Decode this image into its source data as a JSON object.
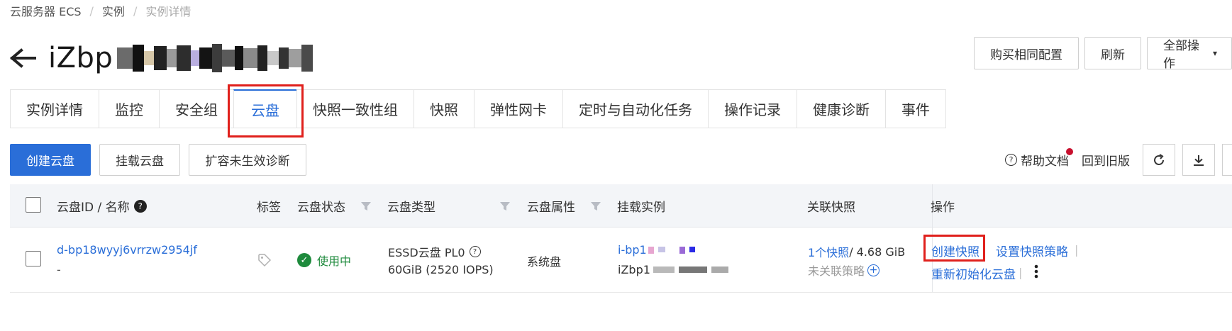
{
  "breadcrumb": {
    "items": [
      "云服务器 ECS",
      "实例",
      "实例详情"
    ],
    "separator": "/"
  },
  "header": {
    "title": "iZbp"
  },
  "top_actions": {
    "buy_same": "购买相同配置",
    "refresh": "刷新",
    "all_ops": "全部操作"
  },
  "tabs": [
    "实例详情",
    "监控",
    "安全组",
    "云盘",
    "快照一致性组",
    "快照",
    "弹性网卡",
    "定时与自动化任务",
    "操作记录",
    "健康诊断",
    "事件"
  ],
  "active_tab": "云盘",
  "toolbar": {
    "create_disk": "创建云盘",
    "attach_disk": "挂载云盘",
    "resize_diag": "扩容未生效诊断"
  },
  "toolbar_right": {
    "help_docs": "帮助文档",
    "old_version": "回到旧版"
  },
  "table": {
    "columns": {
      "id_name": "云盘ID / 名称",
      "tags": "标签",
      "status": "云盘状态",
      "type": "云盘类型",
      "attribute": "云盘属性",
      "instance": "挂载实例",
      "snapshot": "关联快照",
      "ops": "操作"
    },
    "rows": [
      {
        "id": "d-bp18wyyj6vrrzw2954jf",
        "name": "-",
        "status": "使用中",
        "type": "ESSD云盘 PL0",
        "spec": "60GiB (2520 IOPS)",
        "attribute": "系统盘",
        "instance_id": "i-bp1",
        "instance_name": "iZbp1",
        "snapshot_count": "1个快照",
        "snapshot_size": " / 4.68 GiB",
        "snapshot_policy": "未关联策略",
        "actions": {
          "create_snapshot": "创建快照",
          "set_policy": "设置快照策略",
          "reinit": "重新初始化云盘"
        }
      }
    ]
  },
  "colors": {
    "accent": "#2a6ed8",
    "highlight": "#e0201c",
    "success": "#1e8a3c"
  }
}
